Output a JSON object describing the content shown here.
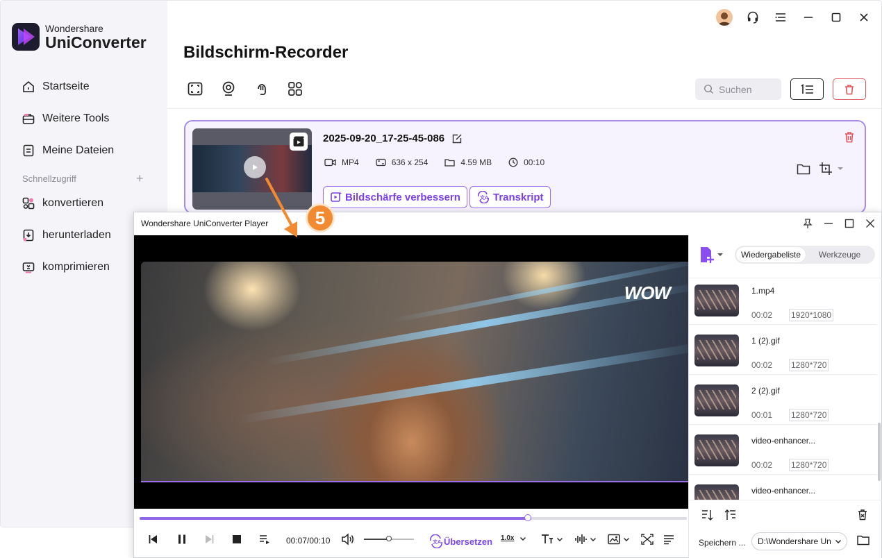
{
  "app": {
    "brand": "Wondershare",
    "product": "UniConverter"
  },
  "sidebar": {
    "items": [
      {
        "label": "Startseite",
        "icon": "home-icon"
      },
      {
        "label": "Weitere Tools",
        "icon": "toolbox-icon"
      },
      {
        "label": "Meine Dateien",
        "icon": "file-icon"
      }
    ],
    "quick_access_label": "Schnellzugriff",
    "quick_items": [
      {
        "label": "konvertieren",
        "icon": "convert-icon"
      },
      {
        "label": "herunterladen",
        "icon": "download-icon"
      },
      {
        "label": "komprimieren",
        "icon": "compress-icon"
      }
    ]
  },
  "header": {
    "title": "Bildschirm-Recorder",
    "search_placeholder": "Suchen"
  },
  "recording": {
    "name": "2025-09-20_17-25-45-086",
    "format": "MP4",
    "resolution": "636 x 254",
    "size": "4.59 MB",
    "duration": "00:10",
    "enhance_label": "Bildschärfe verbessern",
    "transcript_label": "Transkript"
  },
  "annotation": {
    "step": "5",
    "accent": "#f28a32"
  },
  "player": {
    "title": "Wondershare UniConverter Player",
    "watermark": "WOW",
    "progress": 0.71,
    "volume": 0.5,
    "time": "00:07/00:10",
    "translate_label": "Übersetzen",
    "speed": "1.0x",
    "tabs": [
      "Wiedergabeliste",
      "Werkzeuge"
    ],
    "active_tab": "Wiedergabeliste",
    "playlist": [
      {
        "name": "1.mp4",
        "duration": "00:02",
        "resolution": "1920*1080"
      },
      {
        "name": "1 (2).gif",
        "duration": "00:02",
        "resolution": "1280*720"
      },
      {
        "name": "2 (2).gif",
        "duration": "00:01",
        "resolution": "1280*720"
      },
      {
        "name": "video-enhancer...",
        "duration": "00:02",
        "resolution": "1280*720"
      },
      {
        "name": "video-enhancer...",
        "duration": "",
        "resolution": ""
      }
    ],
    "save_label": "Speichern ...",
    "save_path": "D:\\Wondershare Un"
  },
  "colors": {
    "accent_purple": "#7b3fe8",
    "danger_red": "#e0535a"
  }
}
